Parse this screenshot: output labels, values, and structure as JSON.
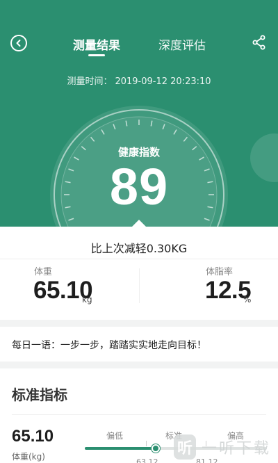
{
  "header": {
    "tabs": [
      {
        "label": "测量结果",
        "active": true
      },
      {
        "label": "深度评估",
        "active": false
      }
    ],
    "measure_time_label": "测量时间：",
    "measure_time_value": "2019-09-12 20:23:10"
  },
  "gauge": {
    "label": "健康指数",
    "score": "89"
  },
  "summary": {
    "weight_change": "比上次减轻0.30KG",
    "weight_label": "体重",
    "weight_value": "65.10",
    "weight_unit": "kg",
    "bodyfat_label": "体脂率",
    "bodyfat_value": "12.5",
    "bodyfat_unit": "%"
  },
  "quote": {
    "text": "每日一语：一步一步，踏踏实实地走向目标！"
  },
  "standard": {
    "title": "标准指标",
    "value": "65.10",
    "sublabel": "体重(kg)",
    "ranges": [
      "偏低",
      "标准",
      "偏高"
    ],
    "ticks": [
      "63.12",
      "81.12"
    ],
    "position_fraction": 0.39
  },
  "watermark": {
    "logo_char": "听",
    "text": "一听下载"
  },
  "colors": {
    "primary": "#2b8f70",
    "background": "#f2f3f3"
  }
}
